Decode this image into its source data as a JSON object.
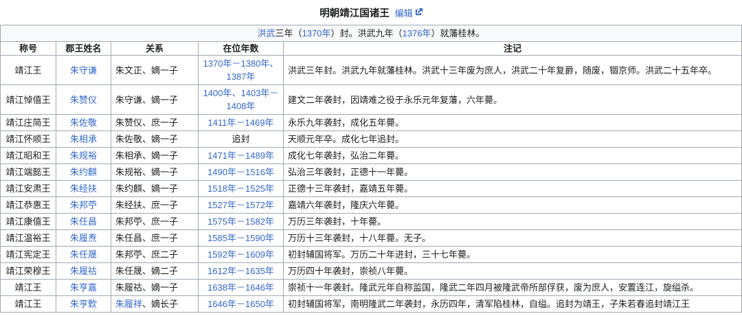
{
  "colors": {
    "link_blue": "#3366cc",
    "header_bg": "#eaecf0",
    "subtitle_bg": "#f8f9fa",
    "border": "#a2a9b1",
    "text": "#202122"
  },
  "title": {
    "text": "明朝靖江国诸王",
    "edit_label": "编辑",
    "edit_icon": "external-link-icon"
  },
  "subtitle": {
    "segments": [
      {
        "text": "洪武",
        "link": true
      },
      {
        "text": "三年（",
        "link": false
      },
      {
        "text": "1370年",
        "link": true
      },
      {
        "text": "）封。洪武九年（",
        "link": false
      },
      {
        "text": "1376年",
        "link": true
      },
      {
        "text": "）就藩桂林。",
        "link": false
      }
    ]
  },
  "table": {
    "headers": [
      "称号",
      "郡王姓名",
      "关系",
      "在位年数",
      "注记"
    ],
    "rows": [
      {
        "title": "靖江王",
        "name": "朱守谦",
        "relation_link": "",
        "relation_rest": "朱文正、嫡一子",
        "reign": "1370年－1380年、1387年",
        "reign_link": true,
        "note": "洪武三年封。洪武九年就藩桂林。洪武十三年废为庶人，洪武二十年复爵，随废，锢京师。洪武二十五年卒。"
      },
      {
        "title": "靖江悼僖王",
        "name": "朱赞仪",
        "relation_link": "",
        "relation_rest": "朱守谦、嫡一子",
        "reign": "1400年、1403年－1408年",
        "reign_link": true,
        "note": "建文二年袭封，因靖难之役于永乐元年复藩，六年薨。"
      },
      {
        "title": "靖江庄简王",
        "name": "朱佐敬",
        "relation_link": "",
        "relation_rest": "朱赞仪、庶一子",
        "reign": "1411年－1469年",
        "reign_link": true,
        "note": "永乐九年袭封，成化五年薨。"
      },
      {
        "title": "靖江怀顺王",
        "name": "朱相承",
        "relation_link": "",
        "relation_rest": "朱佐敬、嫡一子",
        "reign": "追封",
        "reign_link": false,
        "note": "天顺元年卒。成化七年追封。"
      },
      {
        "title": "靖江昭和王",
        "name": "朱规裕",
        "relation_link": "",
        "relation_rest": "朱相承、嫡一子",
        "reign": "1471年－1489年",
        "reign_link": true,
        "note": "成化七年袭封，弘治二年薨。"
      },
      {
        "title": "靖江端懿王",
        "name": "朱约麒",
        "relation_link": "",
        "relation_rest": "朱规裕、嫡一子",
        "reign": "1490年－1516年",
        "reign_link": true,
        "note": "弘治三年袭封，正德十一年薨。"
      },
      {
        "title": "靖江安肃王",
        "name": "朱经扶",
        "relation_link": "",
        "relation_rest": "朱约麒、嫡一子",
        "reign": "1518年－1525年",
        "reign_link": true,
        "note": "正德十三年袭封，嘉靖五年薨。"
      },
      {
        "title": "靖江恭惠王",
        "name": "朱邦苧",
        "relation_link": "",
        "relation_rest": "朱经扶、庶一子",
        "reign": "1527年－1572年",
        "reign_link": true,
        "note": "嘉靖六年袭封，隆庆六年薨。"
      },
      {
        "title": "靖江康僖王",
        "name": "朱任昌",
        "relation_link": "",
        "relation_rest": "朱邦苧、庶一子",
        "reign": "1575年－1582年",
        "reign_link": true,
        "note": "万历三年袭封，十年薨。"
      },
      {
        "title": "靖江温裕王",
        "name": "朱履焘",
        "relation_link": "",
        "relation_rest": "朱任昌、庶一子",
        "reign": "1585年－1590年",
        "reign_link": true,
        "note": "万历十三年袭封，十八年薨。无子。"
      },
      {
        "title": "靖江宪定王",
        "name": "朱任晟",
        "relation_link": "",
        "relation_rest": "朱邦苧、庶二子",
        "reign": "1592年－1609年",
        "reign_link": true,
        "note": "初封辅国将军。万历二十年进封，三十七年薨。"
      },
      {
        "title": "靖江荣穆王",
        "name": "朱履祜",
        "relation_link": "",
        "relation_rest": "朱任晟、嫡二子",
        "reign": "1612年－1635年",
        "reign_link": true,
        "note": "万历四十年袭封，崇祯八年薨。"
      },
      {
        "title": "靖江王",
        "name": "朱亨嘉",
        "relation_link": "",
        "relation_rest": "朱履祜、嫡一子",
        "reign": "1638年－1646年",
        "reign_link": true,
        "note": "崇祯十一年袭封。隆武元年自称监国，隆武二年四月被隆武帝所部俘获，废为庶人，安置连江，旋缢杀。"
      },
      {
        "title": "靖江王",
        "name": "朱亨歅",
        "relation_link": "朱履祥",
        "relation_rest": "、嫡长子",
        "reign": "1646年－1650年",
        "reign_link": true,
        "note": "初封辅国将军，南明隆武二年袭封，永历四年，清军陷桂林，自缢。追封为靖王，子朱若春追封靖江王"
      }
    ]
  }
}
